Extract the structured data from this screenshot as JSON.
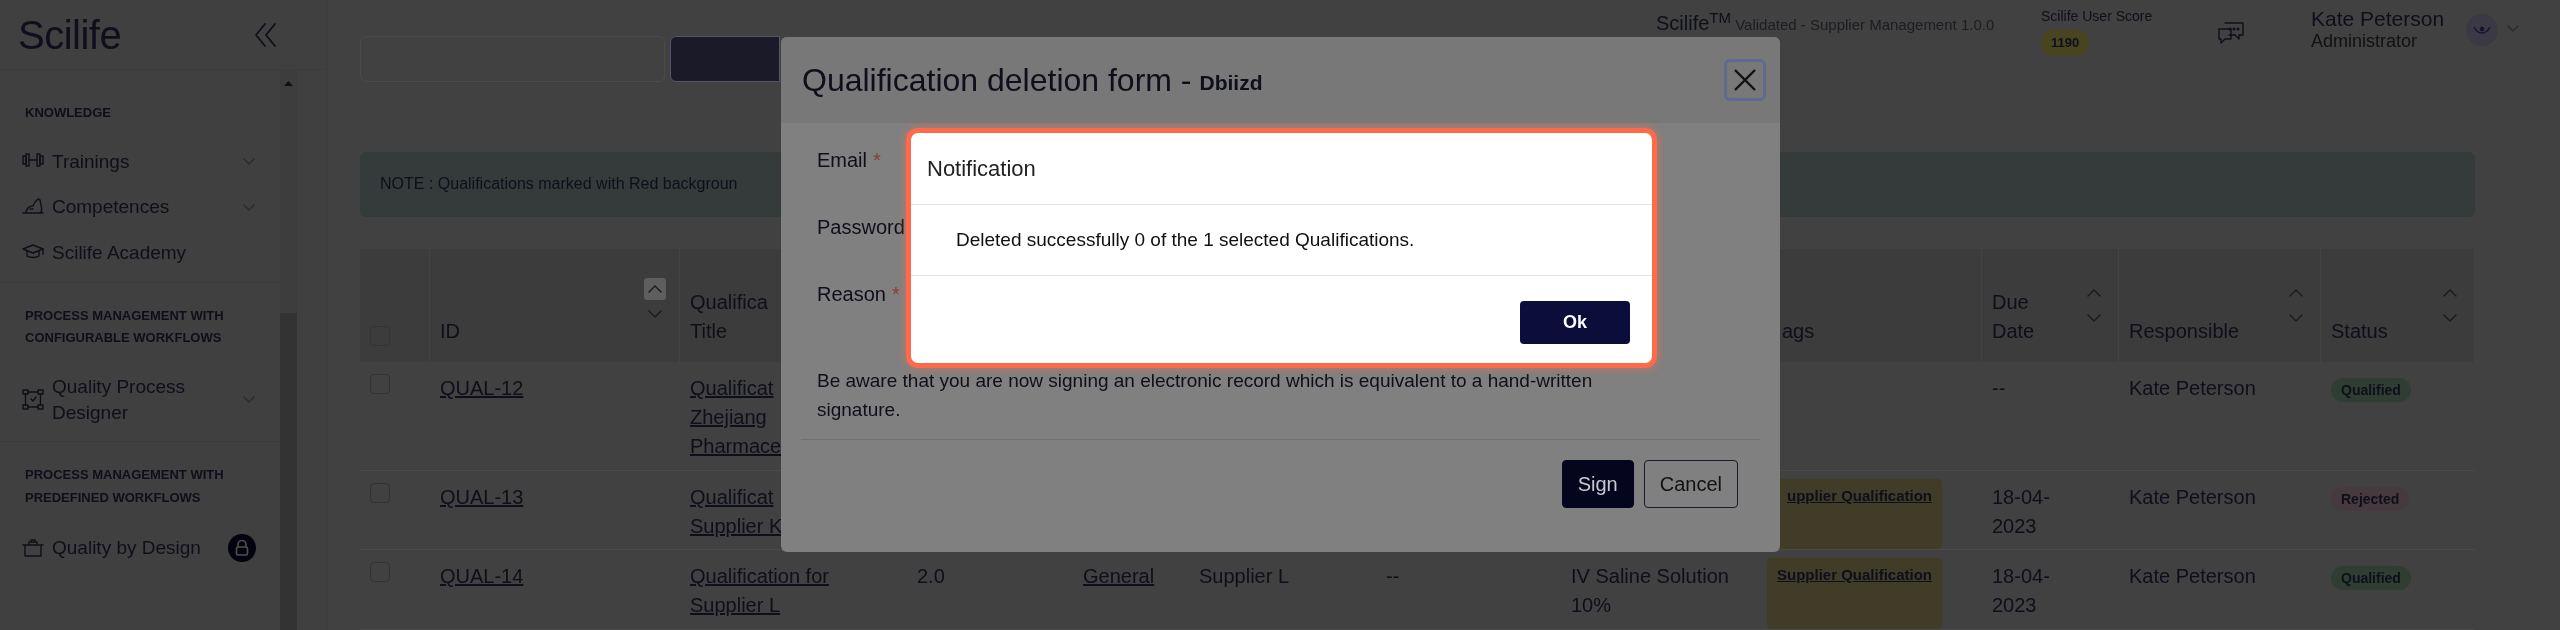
{
  "sidebar": {
    "logo": "Scilife",
    "sections": [
      {
        "heading": "KNOWLEDGE",
        "items": [
          {
            "label": "Trainings",
            "has_submenu": true,
            "locked": false
          },
          {
            "label": "Competences",
            "has_submenu": true,
            "locked": false
          },
          {
            "label": "Scilife Academy",
            "has_submenu": false,
            "locked": false
          }
        ]
      },
      {
        "heading": "PROCESS MANAGEMENT WITH CONFIGURABLE WORKFLOWS",
        "items": [
          {
            "label": "Quality Process Designer",
            "has_submenu": true,
            "locked": false
          }
        ]
      },
      {
        "heading": "PROCESS MANAGEMENT WITH PREDEFINED WORKFLOWS",
        "items": [
          {
            "label": "Quality by Design",
            "has_submenu": false,
            "locked": true
          }
        ]
      }
    ]
  },
  "header": {
    "brand": "Scilife$^{TM}$",
    "product": "Validated - Supplier Management 1.0.0",
    "score_label": "Scilife User Score",
    "score": "1190",
    "user_name": "Kate Peterson",
    "user_role": "Administrator"
  },
  "note": "NOTE : Qualifications marked with Red backgroun",
  "table": {
    "header_checked": false,
    "columns": [
      {
        "label": "ID",
        "sorted": true
      },
      {
        "label": "Qualifica Title"
      },
      {
        "label": "ags"
      },
      {
        "label": "Due Date",
        "sorted": false
      },
      {
        "label": "Responsible",
        "sorted": false
      },
      {
        "label": "Status",
        "sorted": false
      }
    ],
    "rows": [
      {
        "checked": false,
        "id": "QUAL-12",
        "title": "Qualificat Zhejiang Pharmace",
        "due_date": "--",
        "responsible": "Kate Peterson",
        "status": {
          "label": "Qualified",
          "color": "#2f3d33"
        }
      },
      {
        "checked": false,
        "id": "QUAL-13",
        "title": "Qualificat Supplier K",
        "tags": [
          "upplier Qualification"
        ],
        "due_date": "18-04-2023",
        "responsible": "Kate Peterson",
        "status": {
          "label": "Rejected",
          "color": "#473a3f"
        }
      },
      {
        "checked": false,
        "id": "QUAL-14",
        "title": "Qualification for Supplier L",
        "version": "2.0",
        "type": "General",
        "supplier": "Supplier L",
        "column_7": "--",
        "product": "IV Saline Solution 10%",
        "tags": [
          "Supplier Qualification"
        ],
        "due_date": "18-04-2023",
        "responsible": "Kate Peterson",
        "status": {
          "label": "Qualified",
          "color": "#2f3d33"
        }
      }
    ]
  },
  "sign_dialog": {
    "title": "Qualification deletion form - ",
    "subtitle": "Dbiizd",
    "required_mark": "*",
    "fields": [
      {
        "label": "Email",
        "required": true
      },
      {
        "label": "Password",
        "required": false
      },
      {
        "label": "Reason",
        "required": true
      }
    ],
    "warning": "Be aware that you are now signing an electronic record which is equivalent to a hand-written signature.",
    "buttons": [
      {
        "label": "Sign",
        "kind": "primary"
      },
      {
        "label": "Cancel",
        "kind": "secondary"
      }
    ]
  },
  "notification": {
    "title": "Notification",
    "message": "Deleted successfully 0 of the 1 selected Qualifications.",
    "button": "Ok"
  }
}
